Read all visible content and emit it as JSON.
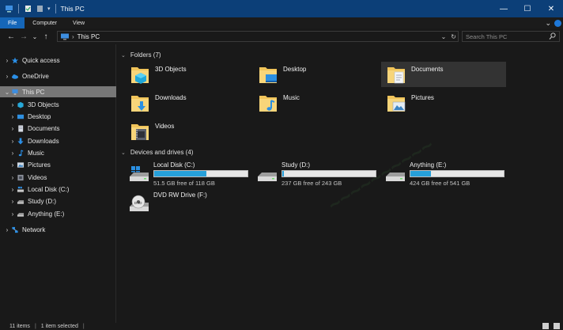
{
  "window": {
    "title": "This PC",
    "controls": [
      "minimize",
      "maximize",
      "close"
    ]
  },
  "ribbon": {
    "tabs": [
      {
        "label": "File",
        "active": true
      },
      {
        "label": "Computer",
        "active": false
      },
      {
        "label": "View",
        "active": false
      }
    ]
  },
  "address": {
    "breadcrumb": "This PC",
    "search_placeholder": "Search This PC"
  },
  "nav": {
    "items": [
      {
        "label": "Quick access",
        "level": 0,
        "icon": "star-icon",
        "expander": true,
        "selected": false
      },
      {
        "label": "OneDrive",
        "level": 0,
        "icon": "cloud-icon",
        "expander": true,
        "selected": false
      },
      {
        "label": "This PC",
        "level": 0,
        "icon": "pc-icon",
        "expander": true,
        "expanded": true,
        "selected": true
      },
      {
        "label": "3D Objects",
        "level": 1,
        "icon": "cube-folder-icon",
        "expander": true,
        "selected": false
      },
      {
        "label": "Desktop",
        "level": 1,
        "icon": "desktop-folder-icon",
        "expander": true,
        "selected": false
      },
      {
        "label": "Documents",
        "level": 1,
        "icon": "documents-folder-icon",
        "expander": true,
        "selected": false
      },
      {
        "label": "Downloads",
        "level": 1,
        "icon": "download-icon",
        "expander": true,
        "selected": false
      },
      {
        "label": "Music",
        "level": 1,
        "icon": "music-note-icon",
        "expander": true,
        "selected": false
      },
      {
        "label": "Pictures",
        "level": 1,
        "icon": "pictures-icon",
        "expander": true,
        "selected": false
      },
      {
        "label": "Videos",
        "level": 1,
        "icon": "film-icon",
        "expander": true,
        "selected": false
      },
      {
        "label": "Local Disk (C:)",
        "level": 1,
        "icon": "windows-drive-icon",
        "expander": true,
        "selected": false
      },
      {
        "label": "Study (D:)",
        "level": 1,
        "icon": "drive-icon",
        "expander": true,
        "selected": false
      },
      {
        "label": "Anything (E:)",
        "level": 1,
        "icon": "drive-icon",
        "expander": true,
        "selected": false
      },
      {
        "label": "Network",
        "level": 0,
        "icon": "network-icon",
        "expander": true,
        "selected": false
      }
    ]
  },
  "folders": {
    "header": "Folders (7)",
    "items": [
      {
        "label": "3D Objects",
        "icon": "cube-folder-icon",
        "selected": false
      },
      {
        "label": "Desktop",
        "icon": "desktop-folder-icon",
        "selected": false
      },
      {
        "label": "Documents",
        "icon": "documents-folder-icon",
        "selected": true
      },
      {
        "label": "Downloads",
        "icon": "downloads-folder-icon",
        "selected": false
      },
      {
        "label": "Music",
        "icon": "music-folder-icon",
        "selected": false
      },
      {
        "label": "Pictures",
        "icon": "pictures-folder-icon",
        "selected": false
      },
      {
        "label": "Videos",
        "icon": "videos-folder-icon",
        "selected": false
      }
    ]
  },
  "drives": {
    "header": "Devices and drives (4)",
    "items": [
      {
        "name": "Local Disk (C:)",
        "free_text": "51.5 GB free of 118 GB",
        "used_fraction": 0.56,
        "icon": "windows-drive-icon"
      },
      {
        "name": "Study (D:)",
        "free_text": "237 GB free of 243 GB",
        "used_fraction": 0.02,
        "icon": "drive-icon"
      },
      {
        "name": "Anything (E:)",
        "free_text": "424 GB free of 541 GB",
        "used_fraction": 0.22,
        "icon": "drive-icon"
      },
      {
        "name": "DVD RW Drive (F:)",
        "free_text": "",
        "used_fraction": null,
        "icon": "dvd-drive-icon"
      }
    ]
  },
  "status": {
    "item_count": "11 items",
    "selected": "1 item selected"
  },
  "colors": {
    "titlebar": "#0c3f78",
    "accent": "#1566b8",
    "drive_fill": "#26a0da",
    "background": "#191919"
  }
}
